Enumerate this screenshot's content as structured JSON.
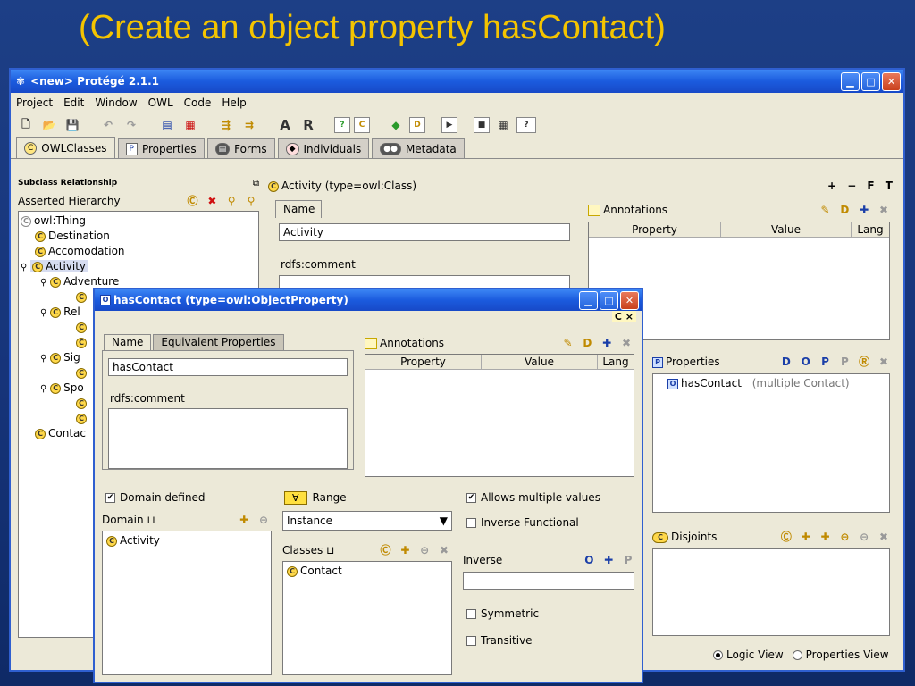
{
  "slide": {
    "title": "(Create an object property hasContact)"
  },
  "window": {
    "title": "<new>  Protégé 2.1.1"
  },
  "menu": [
    "Project",
    "Edit",
    "Window",
    "OWL",
    "Code",
    "Help"
  ],
  "toolbar": {
    "a_label": "A",
    "r_label": "R"
  },
  "tabs": [
    {
      "label": "OWLClasses",
      "icon": "C"
    },
    {
      "label": "Properties",
      "icon": "P"
    },
    {
      "label": "Forms",
      "icon": ""
    },
    {
      "label": "Individuals",
      "icon": ""
    },
    {
      "label": "Metadata",
      "icon": ""
    }
  ],
  "left_panel": {
    "header": "Subclass Relationship",
    "hierarchy_label": "Asserted Hierarchy",
    "tree": [
      {
        "label": "owl:Thing",
        "level": 0
      },
      {
        "label": "Destination",
        "level": 1
      },
      {
        "label": "Accomodation",
        "level": 1
      },
      {
        "label": "Activity",
        "level": 0,
        "selected": true
      },
      {
        "label": "Adventure",
        "level": 1
      },
      {
        "label": "Rel",
        "level": 1
      },
      {
        "label": "Sig",
        "level": 1
      },
      {
        "label": "Spo",
        "level": 1
      },
      {
        "label": "Contac",
        "level": 1
      }
    ]
  },
  "class_editor": {
    "header": "Activity    (type=owl:Class)",
    "header_actions": "+ − F T",
    "name_tab": "Name",
    "name_value": "Activity",
    "comment_label": "rdfs:comment",
    "annotations": {
      "title": "Annotations",
      "cols": [
        "Property",
        "Value",
        "Lang"
      ]
    },
    "properties": {
      "title": "Properties",
      "item_name": "hasContact",
      "item_detail": "(multiple Contact)"
    },
    "disjoints": {
      "title": "Disjoints"
    },
    "views": {
      "logic": "Logic View",
      "properties": "Properties View"
    }
  },
  "dialog": {
    "title": "hasContact     (type=owl:ObjectProperty)",
    "corner_actions": "C ×",
    "tabs": [
      "Name",
      "Equivalent Properties"
    ],
    "name_value": "hasContact",
    "comment_label": "rdfs:comment",
    "annotations": {
      "title": "Annotations",
      "cols": [
        "Property",
        "Value",
        "Lang"
      ]
    },
    "domain_defined_label": "Domain defined",
    "domain_label": "Domain ⊔",
    "domain_items": [
      "Activity"
    ],
    "range_label": "Range",
    "range_value": "Instance",
    "classes_label": "Classes ⊔",
    "class_items": [
      "Contact"
    ],
    "allows_multiple_label": "Allows multiple values",
    "inverse_functional_label": "Inverse Functional",
    "inverse_label": "Inverse",
    "symmetric_label": "Symmetric",
    "transitive_label": "Transitive"
  }
}
